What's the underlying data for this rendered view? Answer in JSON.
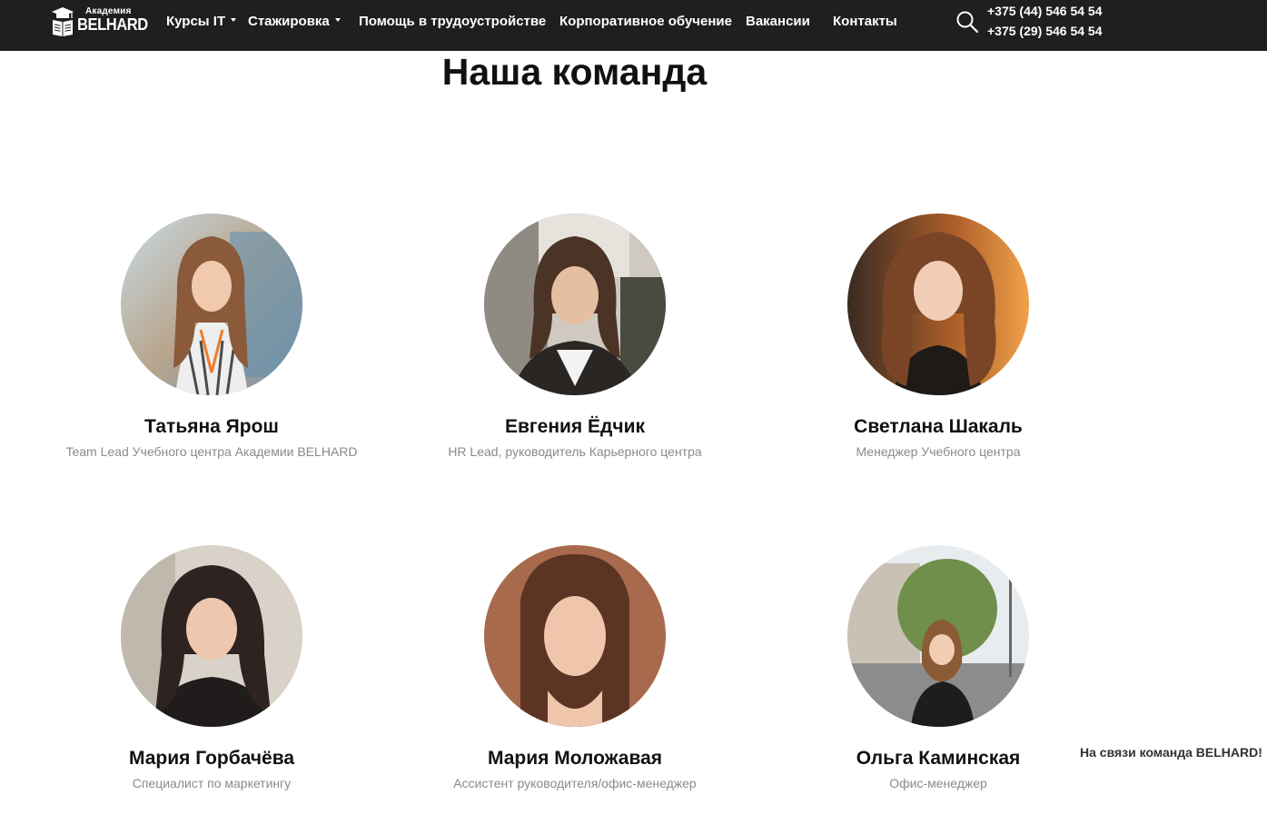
{
  "header": {
    "logo": {
      "subtitle": "Академия",
      "brand": "BELHARD"
    },
    "nav": [
      {
        "label": "Курсы IT",
        "has_dropdown": true
      },
      {
        "label": "Стажировка",
        "has_dropdown": true
      },
      {
        "label": "Помощь в трудоустройстве",
        "has_dropdown": false
      },
      {
        "label": "Корпоративное обучение",
        "has_dropdown": false
      },
      {
        "label": "Вакансии",
        "has_dropdown": false
      },
      {
        "label": "Контакты",
        "has_dropdown": false
      }
    ],
    "search_icon": "search-icon",
    "phones": [
      "+375 (44) 546 54 54",
      "+375 (29) 546 54 54"
    ]
  },
  "main": {
    "title": "Наша команда",
    "team": [
      {
        "name": "Татьяна Ярош",
        "role": "Team Lead Учебного центра Академии BELHARD"
      },
      {
        "name": "Евгения Ёдчик",
        "role": "HR Lead, руководитель Карьерного центра"
      },
      {
        "name": "Светлана Шакаль",
        "role": "Менеджер Учебного центра"
      },
      {
        "name": "Мария Горбачёва",
        "role": "Специалист по маркетингу"
      },
      {
        "name": "Мария Моложавая",
        "role": "Ассистент руководителя/офис-менеджер"
      },
      {
        "name": "Ольга Каминская",
        "role": "Офис-менеджер"
      }
    ]
  },
  "chat_widget": {
    "label": "На связи команда BELHARD!"
  },
  "colors": {
    "header_bg": "#1f1f1f",
    "role_text": "#8a8a8a"
  }
}
